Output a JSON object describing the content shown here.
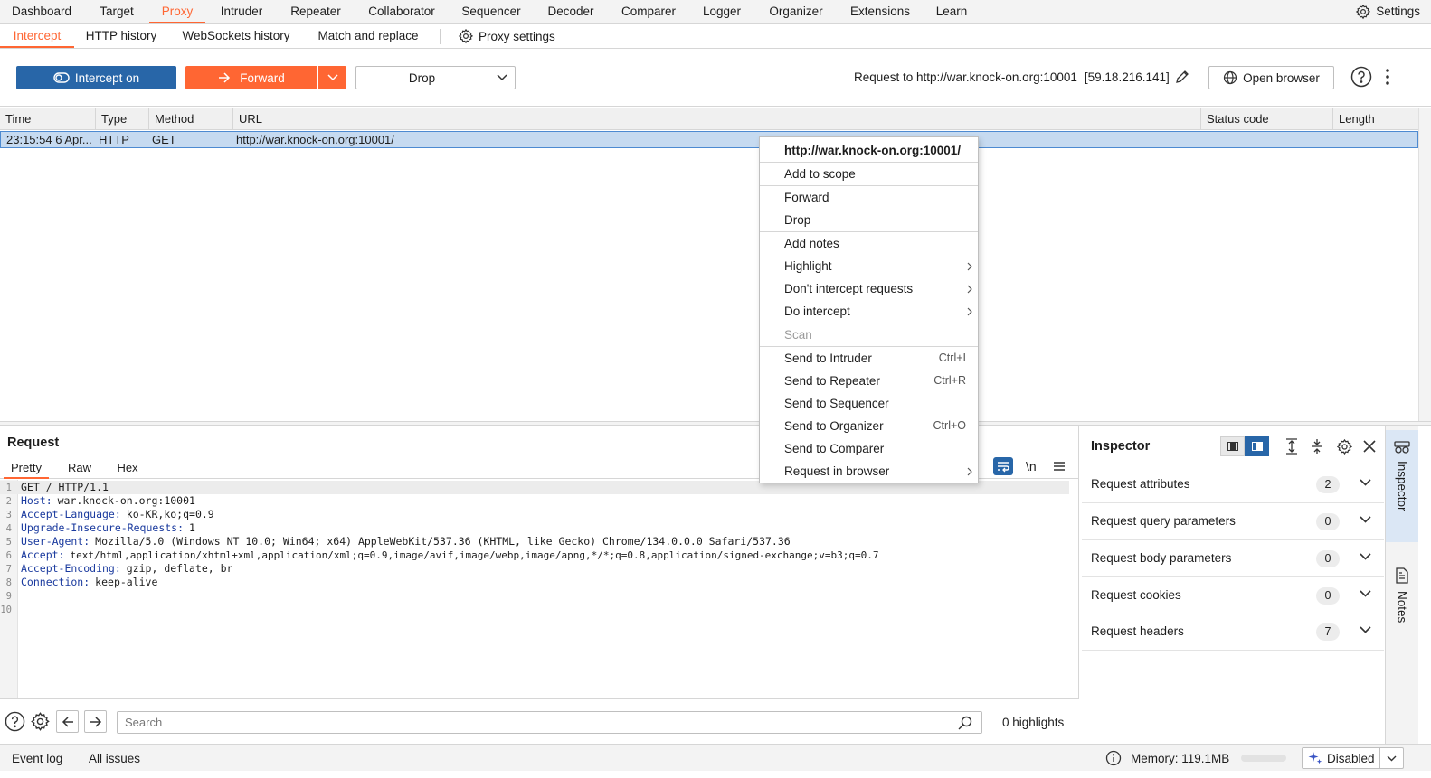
{
  "top_tabs": [
    {
      "label": "Dashboard"
    },
    {
      "label": "Target"
    },
    {
      "label": "Proxy"
    },
    {
      "label": "Intruder"
    },
    {
      "label": "Repeater"
    },
    {
      "label": "Collaborator"
    },
    {
      "label": "Sequencer"
    },
    {
      "label": "Decoder"
    },
    {
      "label": "Comparer"
    },
    {
      "label": "Logger"
    },
    {
      "label": "Organizer"
    },
    {
      "label": "Extensions"
    },
    {
      "label": "Learn"
    }
  ],
  "top_active": "Proxy",
  "settings_label": "Settings",
  "sub_tabs": [
    {
      "label": "Intercept"
    },
    {
      "label": "HTTP history"
    },
    {
      "label": "WebSockets history"
    },
    {
      "label": "Match and replace"
    }
  ],
  "proxy_settings_label": "Proxy settings",
  "toolbar": {
    "intercept_label": "Intercept on",
    "forward_label": "Forward",
    "drop_label": "Drop",
    "request_to": "Request to http://war.knock-on.org:10001",
    "ip": "[59.18.216.141]",
    "open_browser_label": "Open browser"
  },
  "table": {
    "columns": [
      "Time",
      "Type",
      "Method",
      "URL",
      "Status code",
      "Length"
    ],
    "rows": [
      {
        "time": "23:15:54 6 Apr...",
        "type": "HTTP",
        "method": "GET",
        "url": "http://war.knock-on.org:10001/",
        "status": "",
        "length": ""
      }
    ]
  },
  "context_menu": {
    "header": "http://war.knock-on.org:10001/",
    "items": [
      {
        "label": "Add to scope"
      },
      {
        "label": "Forward"
      },
      {
        "label": "Drop"
      },
      {
        "label": "Add notes"
      },
      {
        "label": "Highlight"
      },
      {
        "label": "Don't intercept requests"
      },
      {
        "label": "Do intercept"
      },
      {
        "label": "Scan"
      },
      {
        "label": "Send to Intruder",
        "shortcut": "Ctrl+I"
      },
      {
        "label": "Send to Repeater",
        "shortcut": "Ctrl+R"
      },
      {
        "label": "Send to Sequencer"
      },
      {
        "label": "Send to Organizer",
        "shortcut": "Ctrl+O"
      },
      {
        "label": "Send to Comparer"
      },
      {
        "label": "Request in browser"
      }
    ]
  },
  "request": {
    "title": "Request",
    "tabs": [
      {
        "label": "Pretty"
      },
      {
        "label": "Raw"
      },
      {
        "label": "Hex"
      }
    ],
    "newline_label": "\\n",
    "lines": [
      {
        "num": "1",
        "key": "",
        "text": "GET / HTTP/1.1"
      },
      {
        "num": "2",
        "key": "Host:",
        "text": "war.knock-on.org:10001"
      },
      {
        "num": "3",
        "key": "Accept-Language:",
        "text": "ko-KR,ko;q=0.9"
      },
      {
        "num": "4",
        "key": "Upgrade-Insecure-Requests:",
        "text": "1"
      },
      {
        "num": "5",
        "key": "User-Agent:",
        "text": "Mozilla/5.0 (Windows NT 10.0; Win64; x64) AppleWebKit/537.36 (KHTML, like Gecko) Chrome/134.0.0.0 Safari/537.36"
      },
      {
        "num": "6",
        "key": "Accept:",
        "text": "text/html,application/xhtml+xml,application/xml;q=0.9,image/avif,image/webp,image/apng,*/*;q=0.8,application/signed-exchange;v=b3;q=0.7"
      },
      {
        "num": "7",
        "key": "Accept-Encoding:",
        "text": "gzip, deflate, br"
      },
      {
        "num": "8",
        "key": "Connection:",
        "text": "keep-alive"
      },
      {
        "num": "9",
        "key": "",
        "text": ""
      },
      {
        "num": "10",
        "key": "",
        "text": ""
      }
    ],
    "search_placeholder": "Search",
    "highlights": "0 highlights"
  },
  "inspector": {
    "title": "Inspector",
    "sections": [
      {
        "label": "Request attributes",
        "count": "2"
      },
      {
        "label": "Request query parameters",
        "count": "0"
      },
      {
        "label": "Request body parameters",
        "count": "0"
      },
      {
        "label": "Request cookies",
        "count": "0"
      },
      {
        "label": "Request headers",
        "count": "7"
      }
    ]
  },
  "side_tabs": [
    {
      "label": "Inspector"
    },
    {
      "label": "Notes"
    }
  ],
  "statusbar": {
    "event_log": "Event log",
    "all_issues": "All issues",
    "memory": "Memory: 119.1MB",
    "ai_label": "Disabled"
  },
  "colors": {
    "accent": "#ff6633",
    "primary": "#2866a8",
    "selection": "#c6daf0"
  }
}
